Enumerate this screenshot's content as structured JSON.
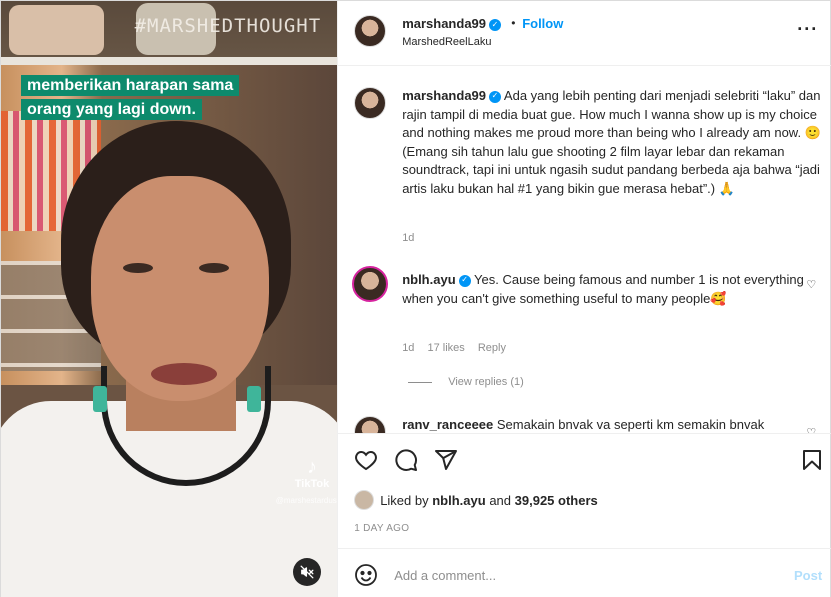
{
  "media": {
    "hashtag": "#MARSHEDTHOUGHT",
    "caption_line1": "memberikan harapan sama",
    "caption_line2": "orang yang lagi down.",
    "watermark_name": "TikTok",
    "watermark_user": "@marshestardust",
    "mute_icon": "speaker-muted-icon"
  },
  "header": {
    "username": "marshanda99",
    "follow_label": "Follow",
    "subtitle": "MarshedReelLaku",
    "more_icon": "more-horizontal-icon"
  },
  "caption_comment": {
    "username": "marshanda99",
    "text": "Ada yang lebih penting dari menjadi selebriti “laku” dan rajin tampil di media buat gue. How much I wanna show up is my choice and nothing makes me proud more than being who I already am now. 🙂 (Emang sih tahun lalu gue shooting 2 film layar lebar dan rekaman soundtrack, tapi ini untuk ngasih sudut pandang berbeda aja bahwa “jadi artis laku bukan hal #1 yang bikin gue merasa hebat”.) 🙏",
    "time": "1d"
  },
  "comments": [
    {
      "username": "nblh.ayu",
      "text": "Yes. Cause being famous and number 1 is not everything when you can't give something useful to many people🥰",
      "time": "1d",
      "likes": "17 likes",
      "reply": "Reply",
      "view_replies": "View replies (1)"
    },
    {
      "username": "ranv_ranceeee",
      "text": "Semakain bnvak va seperti km semakin bnvak"
    }
  ],
  "actions": {
    "liked_by_prefix": "Liked by",
    "liked_by_user": "nblh.ayu",
    "liked_by_and": "and",
    "liked_by_count": "39,925 others",
    "time": "1 DAY AGO"
  },
  "add_comment": {
    "placeholder": "Add a comment...",
    "post_label": "Post"
  },
  "colors": {
    "accent": "#0095f6",
    "caption_bg": "#0d8a6c",
    "post_disabled": "#b2dffc"
  }
}
